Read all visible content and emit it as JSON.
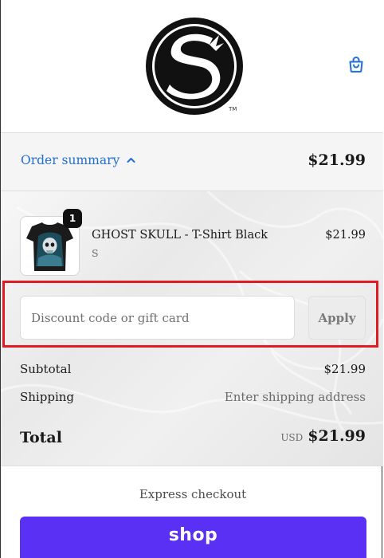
{
  "header": {
    "logo_tm": "TM",
    "cart_icon": "shopping-bag-icon"
  },
  "order_summary": {
    "toggle_label": "Order summary",
    "toggle_icon": "chevron-up-icon",
    "total": "$21.99"
  },
  "line_item": {
    "quantity": "1",
    "name": "GHOST SKULL - T-Shirt Black",
    "variant": "S",
    "price": "$21.99"
  },
  "discount": {
    "placeholder": "Discount code or gift card",
    "value": "",
    "apply_label": "Apply"
  },
  "totals": {
    "subtotal_label": "Subtotal",
    "subtotal_value": "$21.99",
    "shipping_label": "Shipping",
    "shipping_value": "Enter shipping address",
    "total_label": "Total",
    "currency": "USD",
    "total_value": "$21.99"
  },
  "express": {
    "label": "Express checkout",
    "shop_label": "shop"
  },
  "colors": {
    "accent_link": "#1f6fd6",
    "shop_pay": "#5a31f4",
    "highlight": "#e01b24"
  }
}
